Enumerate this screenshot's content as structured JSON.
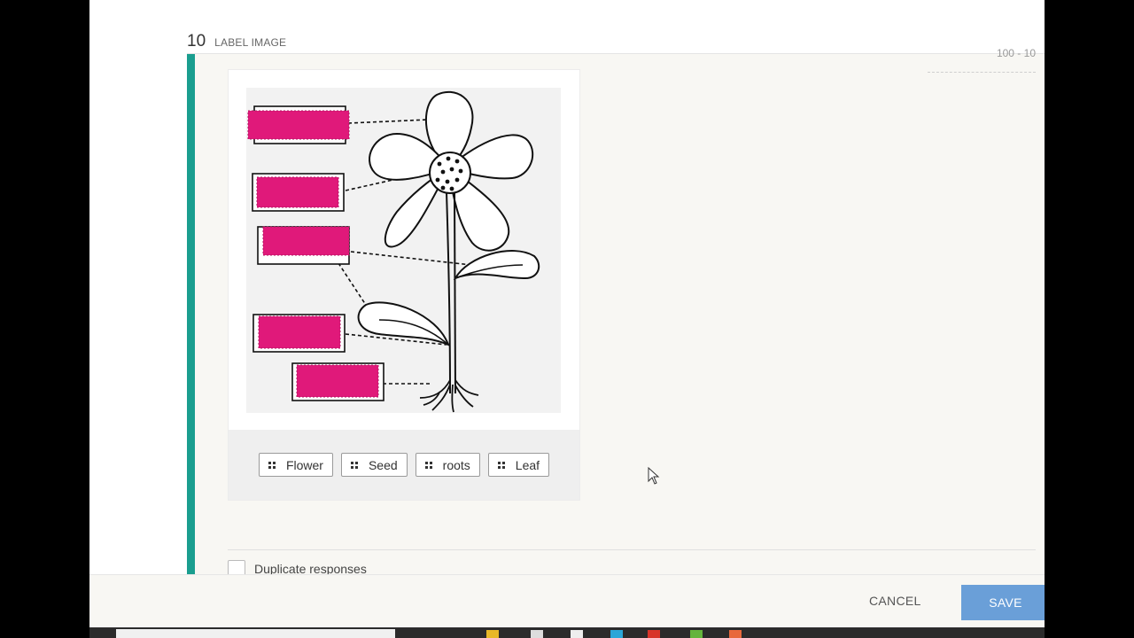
{
  "question": {
    "number": "10",
    "type_label": "LABEL IMAGE",
    "corner_text": "100 - 10"
  },
  "image": {
    "drop_zone_color": "#e0197a",
    "drop_zone_count": 5
  },
  "responses": [
    {
      "label": "Flower"
    },
    {
      "label": "Seed"
    },
    {
      "label": "roots"
    },
    {
      "label": "Leaf"
    }
  ],
  "options": {
    "duplicate_responses_label": "Duplicate responses"
  },
  "footer": {
    "cancel_label": "CANCEL",
    "save_label": "SAVE"
  },
  "colors": {
    "accent": "#1a9e8f",
    "save_button": "#6a9fd8"
  }
}
